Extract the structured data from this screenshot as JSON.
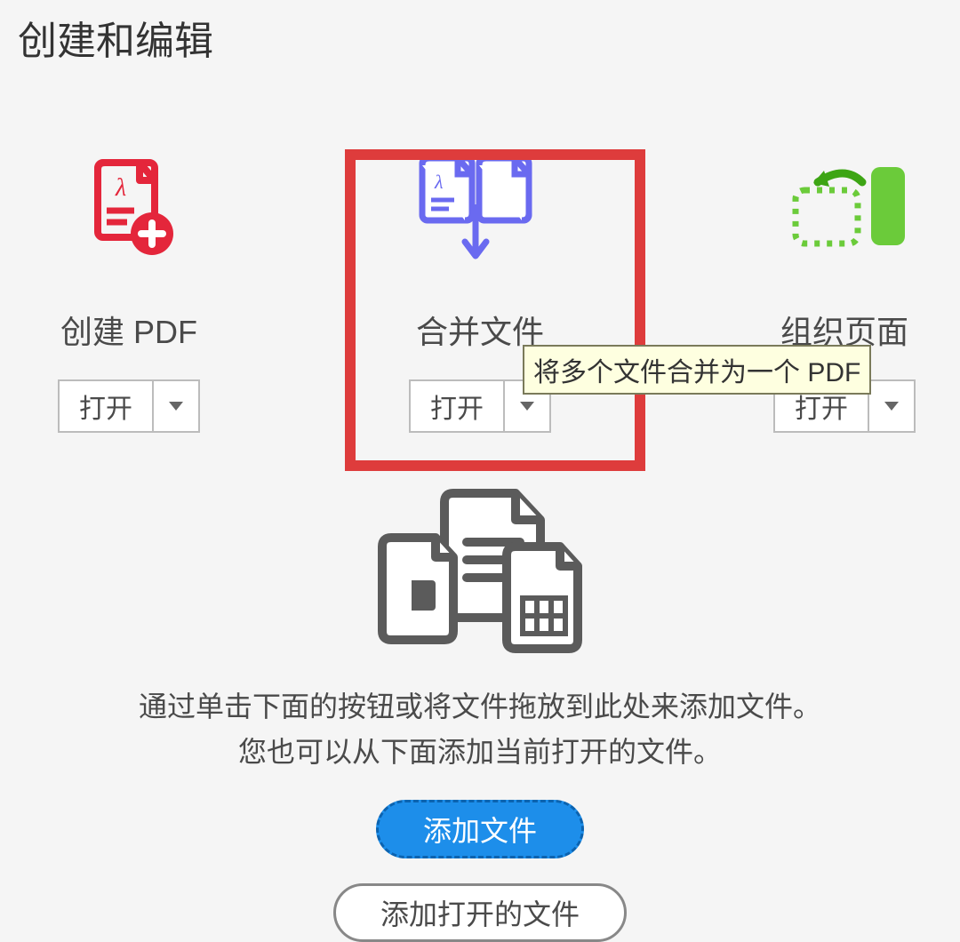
{
  "section_title": "创建和编辑",
  "tools": {
    "create": {
      "label": "创建 PDF",
      "button": "打开"
    },
    "combine": {
      "label": "合并文件",
      "button": "打开",
      "tooltip": "将多个文件合并为一个 PDF"
    },
    "organize": {
      "label": "组织页面",
      "button": "打开"
    }
  },
  "dropzone": {
    "line1": "通过单击下面的按钮或将文件拖放到此处来添加文件。",
    "line2": "您也可以从下面添加当前打开的文件。",
    "add_files": "添加文件",
    "add_open_files": "添加打开的文件"
  }
}
